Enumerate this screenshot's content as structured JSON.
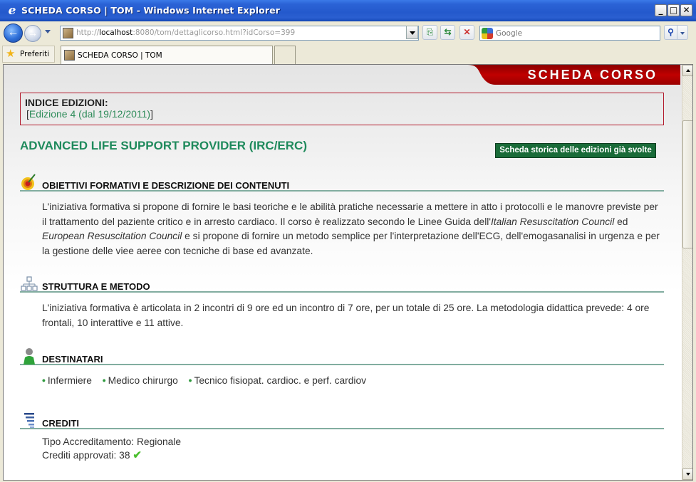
{
  "browser": {
    "window_title": "SCHEDA CORSO | TOM - Windows Internet Explorer",
    "url_prefix": "http://",
    "url_host": "localhost",
    "url_rest": ":8080/tom/dettaglicorso.html?idCorso=399",
    "search_placeholder": "Google",
    "favorites_label": "Preferiti",
    "tab_label": "SCHEDA CORSO | TOM",
    "window_buttons": {
      "minimize": "_",
      "maximize": "□",
      "close": "✕"
    }
  },
  "page": {
    "ribbon_title": "SCHEDA CORSO",
    "indice": {
      "heading": "INDICE EDIZIONI:",
      "open_bracket": "[",
      "edition_link": "Edizione 4 (dal 19/12/2011)",
      "close_bracket": "]"
    },
    "course_title": "ADVANCED LIFE SUPPORT PROVIDER (IRC/ERC)",
    "history_button": "Scheda storica delle edizioni già svolte",
    "sections": {
      "obiettivi": {
        "title": "OBIETTIVI FORMATIVI E DESCRIZIONE DEI CONTENUTI",
        "text_1": "L'iniziativa formativa si propone di fornire le basi teoriche e le abilità pratiche necessarie a mettere in atto i protocolli e le manovre previste per il trattamento del paziente critico e in arresto cardiaco. Il corso è realizzato secondo le Linee Guida dell'",
        "italic_1": "Italian Resuscitation Council",
        "text_2": " ed ",
        "italic_2": "European Resuscitation Council",
        "text_3": " e si propone di fornire un metodo semplice per l'interpretazione dell'ECG, dell'emogasanalisi in urgenza e per la gestione delle viee aeree con tecniche di base ed avanzate."
      },
      "struttura": {
        "title": "STRUTTURA E METODO",
        "text": "L'iniziativa formativa è articolata in 2 incontri di 9 ore ed un incontro di 7 ore, per un totale di 25 ore. La metodologia didattica prevede: 4 ore frontali, 10 interattive e 11 attive."
      },
      "destinatari": {
        "title": "DESTINATARI",
        "bullet": "•",
        "items": [
          "Infermiere",
          "Medico chirurgo",
          "Tecnico fisiopat. cardioc. e perf. cardiov"
        ]
      },
      "crediti": {
        "title": "CREDITI",
        "tipo_label": "Tipo Accreditamento:",
        "tipo_value": "Regionale",
        "crediti_label": "Crediti approvati:",
        "crediti_value": "38",
        "check": "✔"
      }
    }
  },
  "icons": {
    "ie": "e",
    "back": "←",
    "forward": "→",
    "compat": "⎘",
    "refresh": "⇆",
    "stop": "✕",
    "search": "⚲",
    "star": "★"
  },
  "colors": {
    "ribbon_red": "#b30000",
    "accent_green": "#1f8a5c",
    "button_green": "#196b38",
    "indice_border": "#b21a2b",
    "section_rule": "#82ada0"
  }
}
